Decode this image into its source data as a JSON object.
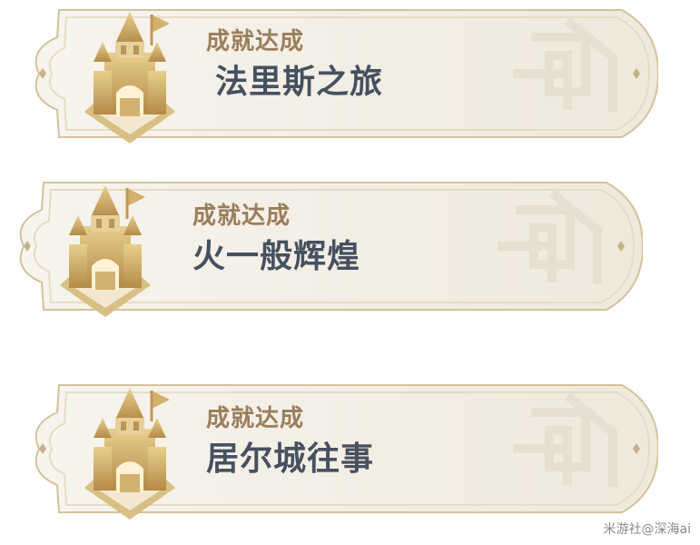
{
  "banners": [
    {
      "caption": "成就达成",
      "title": "法里斯之旅"
    },
    {
      "caption": "成就达成",
      "title": "火一般辉煌"
    },
    {
      "caption": "成就达成",
      "title": "居尔城往事"
    }
  ],
  "watermark": "米游社@深海ai",
  "colors": {
    "caption": "#9a7e5c",
    "title": "#465160",
    "banner_fill": "#f3efe6",
    "banner_border": "#d8c9a7",
    "emblem_gold": "#c9a45f"
  },
  "icons": {
    "emblem": "castle-emblem-icon",
    "sparkle": "four-point-star-icon",
    "ornament": "geometric-knot-ornament-icon"
  }
}
